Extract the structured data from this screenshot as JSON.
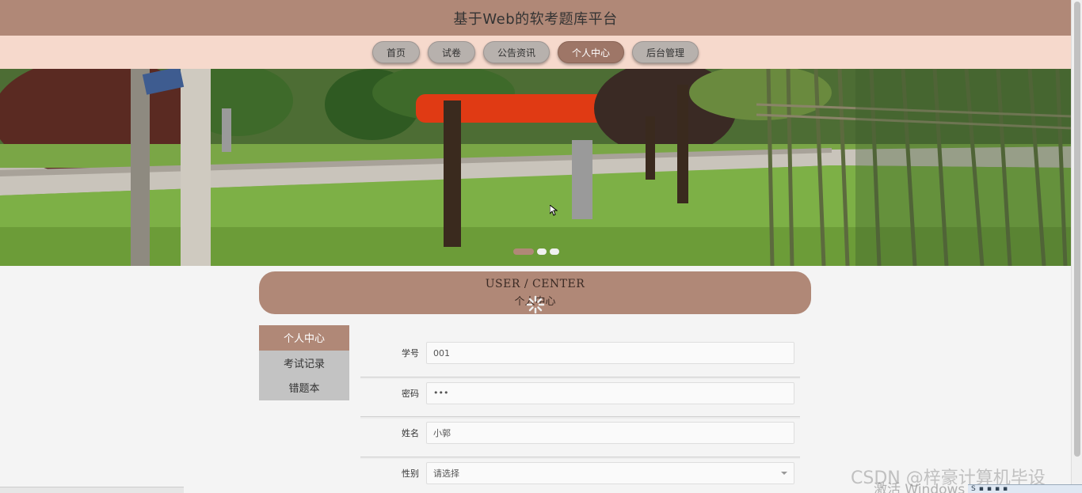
{
  "header": {
    "title": "基于Web的软考题库平台"
  },
  "nav": {
    "items": [
      {
        "label": "首页"
      },
      {
        "label": "试卷"
      },
      {
        "label": "公告资讯"
      },
      {
        "label": "个人中心"
      },
      {
        "label": "后台管理"
      }
    ],
    "active_index": 3
  },
  "banner": {
    "slide_count": 3,
    "active_slide": 0
  },
  "section": {
    "title_en": "USER / CENTER",
    "title_cn": "个人中心"
  },
  "side_menu": {
    "items": [
      {
        "label": "个人中心"
      },
      {
        "label": "考试记录"
      },
      {
        "label": "错题本"
      }
    ],
    "active_index": 0
  },
  "form": {
    "fields": [
      {
        "label": "学号",
        "value": "001",
        "type": "text"
      },
      {
        "label": "密码",
        "value": "•••",
        "type": "password"
      },
      {
        "label": "姓名",
        "value": "小郭",
        "type": "text"
      },
      {
        "label": "性别",
        "value": "请选择",
        "type": "select"
      }
    ]
  },
  "overlay": {
    "watermark": "CSDN @梓豪计算机毕设",
    "activation_text": "激活 Windows"
  },
  "colors": {
    "primary": "#b08877",
    "nav_bg": "#f6d9cc",
    "active_nav": "#9e7667",
    "side_inactive": "#c3c3c3",
    "page_bg": "#f4f4f4"
  }
}
